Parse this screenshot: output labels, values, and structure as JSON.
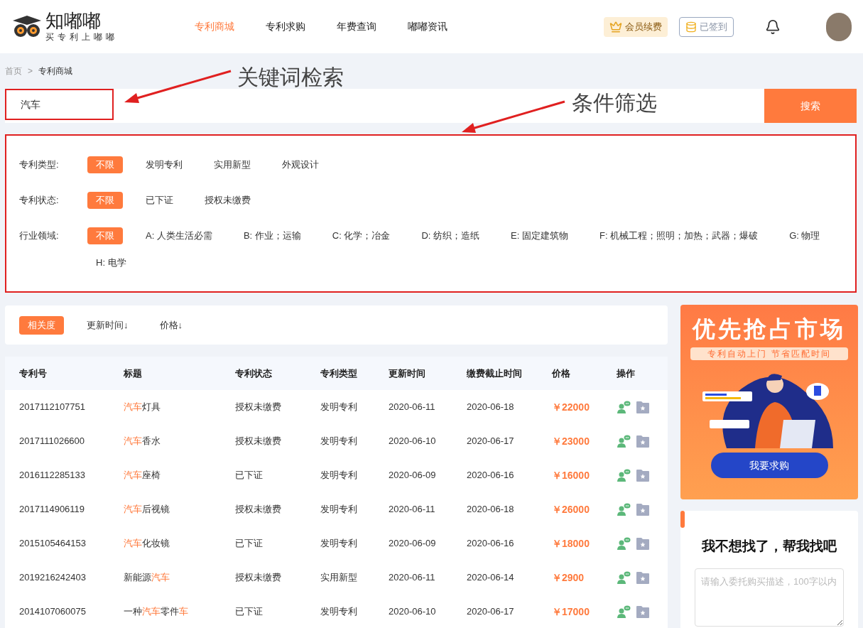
{
  "header": {
    "logo_title": "知嘟嘟",
    "logo_slogan": "买专利上嘟嘟",
    "nav": [
      {
        "label": "专利商城",
        "selected": true
      },
      {
        "label": "专利求购",
        "selected": false
      },
      {
        "label": "年费查询",
        "selected": false
      },
      {
        "label": "嘟嘟资讯",
        "selected": false
      }
    ],
    "vip_button": "会员续费",
    "signin_button": "已签到"
  },
  "breadcrumb": [
    "首页",
    ">",
    "专利商城"
  ],
  "annotations": [
    {
      "text": "关键词检索"
    },
    {
      "text": "条件筛选"
    }
  ],
  "search": {
    "value": "汽车",
    "button": "搜索"
  },
  "filters": [
    {
      "label": "专利类型:",
      "options": [
        {
          "text": "不限",
          "selected": true
        },
        {
          "text": "发明专利",
          "selected": false
        },
        {
          "text": "实用新型",
          "selected": false
        },
        {
          "text": "外观设计",
          "selected": false
        }
      ]
    },
    {
      "label": "专利状态:",
      "options": [
        {
          "text": "不限",
          "selected": true
        },
        {
          "text": "已下证",
          "selected": false
        },
        {
          "text": "授权未缴费",
          "selected": false
        }
      ]
    },
    {
      "label": "行业领域:",
      "options": [
        {
          "text": "不限",
          "selected": true
        },
        {
          "text": "A: 人类生活必需",
          "selected": false
        },
        {
          "text": "B: 作业；运输",
          "selected": false
        },
        {
          "text": "C: 化学；冶金",
          "selected": false
        },
        {
          "text": "D: 纺织；造纸",
          "selected": false
        },
        {
          "text": "E: 固定建筑物",
          "selected": false
        },
        {
          "text": "F: 机械工程；照明；加热；武器；爆破",
          "selected": false
        },
        {
          "text": "G: 物理",
          "selected": false
        },
        {
          "text": "H: 电学",
          "selected": false
        }
      ]
    }
  ],
  "sort": [
    {
      "label": "相关度",
      "selected": true
    },
    {
      "label": "更新时间↓",
      "selected": false
    },
    {
      "label": "价格↓",
      "selected": false
    }
  ],
  "table": {
    "columns": [
      "专利号",
      "标题",
      "专利状态",
      "专利类型",
      "更新时间",
      "缴费截止时间",
      "价格",
      "操作"
    ],
    "rows": [
      {
        "number": "2017112107751",
        "title": [
          {
            "text": "汽车",
            "highlight": true
          },
          {
            "text": "灯具",
            "highlight": false
          }
        ],
        "status": "授权未缴费",
        "type": "发明专利",
        "updated": "2020-06-11",
        "deadline": "2020-06-18",
        "price": "￥22000"
      },
      {
        "number": "2017111026600",
        "title": [
          {
            "text": "汽车",
            "highlight": true
          },
          {
            "text": "香水",
            "highlight": false
          }
        ],
        "status": "授权未缴费",
        "type": "发明专利",
        "updated": "2020-06-10",
        "deadline": "2020-06-17",
        "price": "￥23000"
      },
      {
        "number": "2016112285133",
        "title": [
          {
            "text": "汽车",
            "highlight": true
          },
          {
            "text": "座椅",
            "highlight": false
          }
        ],
        "status": "已下证",
        "type": "发明专利",
        "updated": "2020-06-09",
        "deadline": "2020-06-16",
        "price": "￥16000"
      },
      {
        "number": "2017114906119",
        "title": [
          {
            "text": "汽车",
            "highlight": true
          },
          {
            "text": "后视镜",
            "highlight": false
          }
        ],
        "status": "授权未缴费",
        "type": "发明专利",
        "updated": "2020-06-11",
        "deadline": "2020-06-18",
        "price": "￥26000"
      },
      {
        "number": "2015105464153",
        "title": [
          {
            "text": "汽车",
            "highlight": true
          },
          {
            "text": "化妆镜",
            "highlight": false
          }
        ],
        "status": "已下证",
        "type": "发明专利",
        "updated": "2020-06-09",
        "deadline": "2020-06-16",
        "price": "￥18000"
      },
      {
        "number": "2019216242403",
        "title": [
          {
            "text": "新能源",
            "highlight": false
          },
          {
            "text": "汽车",
            "highlight": true
          }
        ],
        "status": "授权未缴费",
        "type": "实用新型",
        "updated": "2020-06-11",
        "deadline": "2020-06-14",
        "price": "￥2900"
      },
      {
        "number": "2014107060075",
        "title": [
          {
            "text": "一种",
            "highlight": false
          },
          {
            "text": "汽车",
            "highlight": true
          },
          {
            "text": "零件",
            "highlight": false
          },
          {
            "text": "车",
            "highlight": true
          }
        ],
        "status": "已下证",
        "type": "发明专利",
        "updated": "2020-06-10",
        "deadline": "2020-06-17",
        "price": "￥17000"
      }
    ]
  },
  "banner": {
    "headline": "优先抢占市场",
    "subline": "专利自动上门 节省匹配时间",
    "button": "我要求购"
  },
  "request": {
    "title": "我不想找了，帮我找吧",
    "placeholder": "请输入委托购买描述，100字以内"
  }
}
